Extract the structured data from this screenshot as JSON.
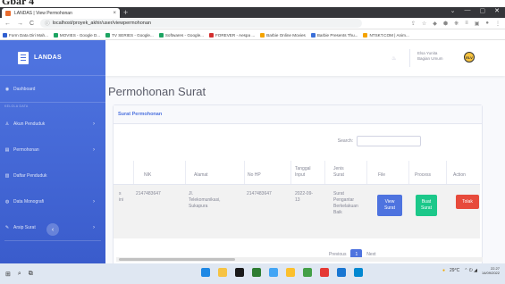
{
  "doc_heading": "Gbar 4",
  "browser": {
    "tab_title": "LANDAS | View Permohonan",
    "tab_close": "×",
    "new_tab": "+",
    "window_controls": [
      "⌄",
      "—",
      "▢",
      "✕"
    ],
    "nav": {
      "back": "←",
      "forward": "→",
      "reload": "C"
    },
    "url": "localhost/proyek_akhir/user/viewpermohonan",
    "url_icon": "ⓘ",
    "extensions": [
      "⇪",
      "☆",
      "◆",
      "⬢",
      "❋",
      "≡",
      "▣",
      "●",
      "⋮"
    ],
    "bookmarks": [
      {
        "label": "Form Data Diri Mah...",
        "color": "#2f5fd0"
      },
      {
        "label": "MOVIES - Google D...",
        "color": "#1da462"
      },
      {
        "label": "TV SERIES - Google...",
        "color": "#1da462"
      },
      {
        "label": "Softwares - Google...",
        "color": "#1da462"
      },
      {
        "label": "FOREVER - Aespa ...",
        "color": "#d32f2f"
      },
      {
        "label": "Barbie Online Movies",
        "color": "#f4a300"
      },
      {
        "label": "Barbie Presents Thu...",
        "color": "#3a6fd8"
      },
      {
        "label": "NTSKT.COM | Anim...",
        "color": "#f4a300"
      }
    ]
  },
  "sidebar": {
    "brand": "LANDAS",
    "items": [
      {
        "icon": "◉",
        "label": "Dashboard",
        "chevron": ""
      },
      {
        "icon": "♙",
        "label": "Akun Penduduk",
        "chevron": "›"
      },
      {
        "icon": "▤",
        "label": "Permohonan",
        "chevron": "›"
      },
      {
        "icon": "▥",
        "label": "Daftar Penduduk",
        "chevron": ""
      },
      {
        "icon": "◍",
        "label": "Data Monografi",
        "chevron": "›"
      },
      {
        "icon": "✎",
        "label": "Arsip Surat",
        "chevron": "›"
      }
    ],
    "heading": "KELOLA DATA",
    "toggle_icon": "‹"
  },
  "topbar": {
    "bell": "♨",
    "user_name": "Elsa Yunita",
    "user_role": "Bagian Umum",
    "avatar_text": "ELV"
  },
  "page": {
    "title": "Permohonan Surat",
    "card_title": "Surat Permohonan",
    "search_label": "Search:",
    "search_value": ""
  },
  "table": {
    "headers": [
      "",
      "NIK",
      "Alamat",
      "No HP",
      "Tanggal\nInput",
      "Jenis\nSurat",
      "File",
      "Process",
      "Action"
    ],
    "row": {
      "cut_name": "s\nini",
      "nik": "2147483647",
      "alamat": "Jl.\nTelekomunikasi,\nSukapura",
      "no_hp": "2147483647",
      "tanggal": "2022-09-\n13",
      "jenis": "Surat\nPengantar\nBerkelakuan\nBaik",
      "btn_view": "View\nSurat",
      "btn_buat": "Buat\nSurat",
      "btn_tolak": "Tolak"
    }
  },
  "pagination": {
    "previous": "Previous",
    "current": "1",
    "next": "Next"
  },
  "taskbar": {
    "start": "⊞",
    "search": "⌕",
    "taskview": "⧉",
    "weather": "29°C",
    "tray_icons": "⌃ ⏻ ◢",
    "time": "22.27",
    "date": "14/09/2022",
    "app_colors": [
      "#1e88e5",
      "#f6c343",
      "#1a1a1a",
      "#2e7d32",
      "#42a5f5",
      "#fbc02d",
      "#43a047",
      "#e53935",
      "#1976d2",
      "#0288d1"
    ]
  }
}
